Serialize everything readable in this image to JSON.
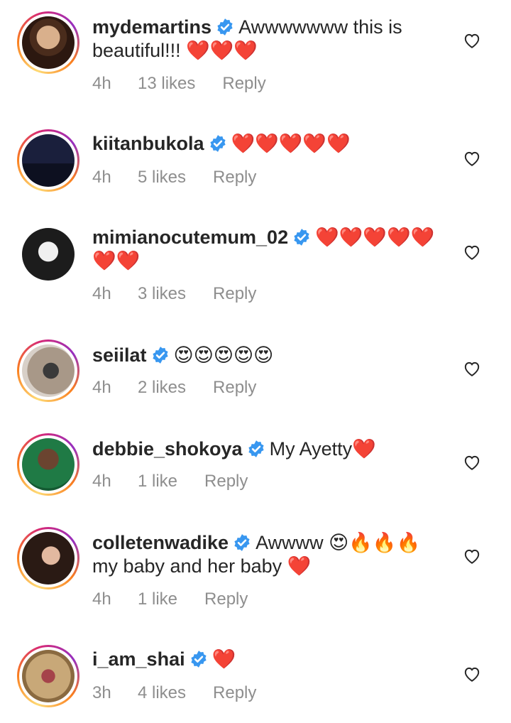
{
  "colors": {
    "verified": "#3897f0",
    "meta": "#8e8e8e",
    "heart": "#e0245e"
  },
  "comments": [
    {
      "username": "mydemartins",
      "text": "Awwwwwww this is beautiful!!! ❤️❤️❤️",
      "time": "4h",
      "likes": "13 likes",
      "reply": "Reply"
    },
    {
      "username": "kiitanbukola",
      "text": "❤️❤️❤️❤️❤️",
      "time": "4h",
      "likes": "5 likes",
      "reply": "Reply"
    },
    {
      "username": "mimianocutemum_02",
      "text": "❤️❤️❤️❤️❤️❤️❤️",
      "time": "4h",
      "likes": "3 likes",
      "reply": "Reply"
    },
    {
      "username": "seiilat",
      "text": "😍😍😍😍😍",
      "time": "4h",
      "likes": "2 likes",
      "reply": "Reply"
    },
    {
      "username": "debbie_shokoya",
      "text": "My Ayetty❤️",
      "time": "4h",
      "likes": "1 like",
      "reply": "Reply"
    },
    {
      "username": "colletenwadike",
      "text": "Awwww 😍🔥🔥🔥 my baby and her baby ❤️",
      "time": "4h",
      "likes": "1 like",
      "reply": "Reply"
    },
    {
      "username": "i_am_shai",
      "text": "❤️",
      "time": "3h",
      "likes": "4 likes",
      "reply": "Reply"
    }
  ]
}
